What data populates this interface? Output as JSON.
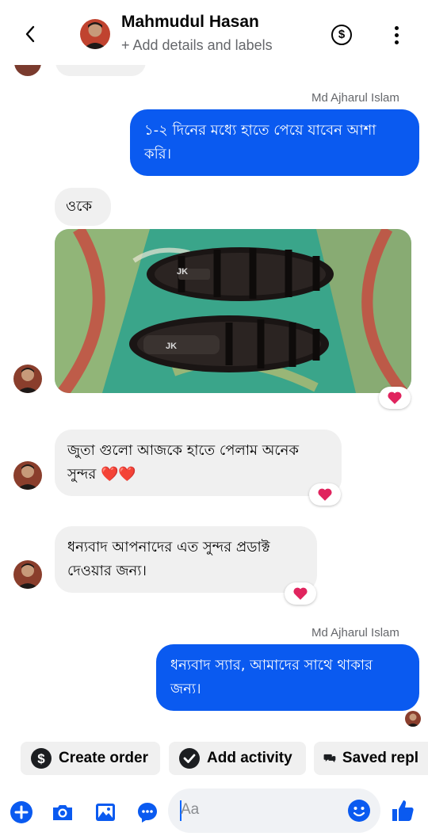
{
  "header": {
    "name": "Mahmudul Hasan",
    "subtitle": "+ Add details and labels",
    "dollar_symbol": "$"
  },
  "messages": [
    {
      "id": "m1",
      "direction": "outgoing",
      "sender_label": "Md Ajharul Islam",
      "text": "১-২  দিনের মধ্যে হাতে পেয়ে যাবেন আশা করি।"
    },
    {
      "id": "m2",
      "direction": "incoming",
      "text": "ওকে"
    },
    {
      "id": "m3",
      "direction": "incoming",
      "type": "image",
      "image_subject": "pair of black leather sandals on a colourful mat",
      "brand_text": "JK",
      "reaction": "heart"
    },
    {
      "id": "m4",
      "direction": "incoming",
      "text": "জুতা গুলো আজকে হাতে পেলাম অনেক সুন্দর ❤️❤️",
      "reaction": "heart"
    },
    {
      "id": "m5",
      "direction": "incoming",
      "text": "ধন্যবাদ আপনাদের এত সুন্দর প্রডাক্ট দেওয়ার জন্য।",
      "reaction": "heart"
    },
    {
      "id": "m6",
      "direction": "outgoing",
      "sender_label": "Md Ajharul Islam",
      "text": "ধন্যবাদ স্যার,  আমাদের সাথে থাকার জন্য।"
    }
  ],
  "quick_actions": [
    {
      "label": "Create order",
      "icon": "dollar-circle-icon"
    },
    {
      "label": "Add activity",
      "icon": "check-circle-icon"
    },
    {
      "label": "Saved repl",
      "icon": "saved-replies-icon"
    }
  ],
  "composer": {
    "placeholder": "Aa",
    "icons": [
      "plus-icon",
      "camera-icon",
      "gallery-icon",
      "chat-bubble-icon",
      "emoji-icon",
      "thumbs-up-icon"
    ]
  },
  "colors": {
    "accent": "#0a5af0",
    "incoming_bubble": "#f0f0f0",
    "heart": "#e0245e",
    "secondary_text": "#65676b"
  }
}
